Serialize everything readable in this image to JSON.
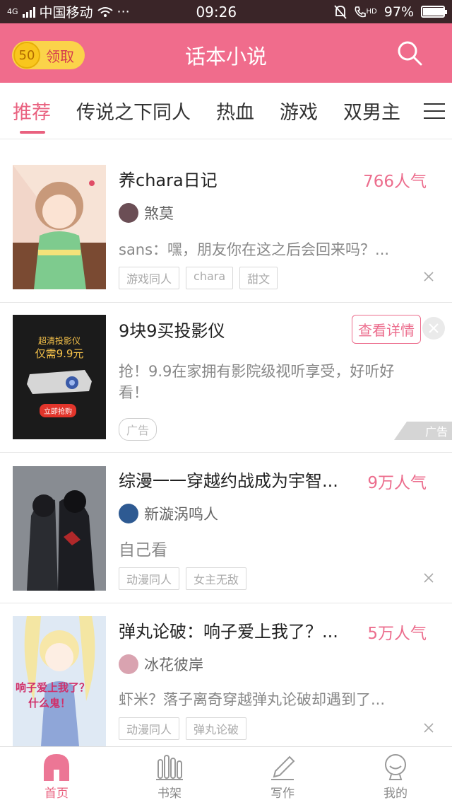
{
  "status_bar": {
    "network": "4G",
    "carrier": "中国移动",
    "dots": "···",
    "time": "09:26",
    "hd": "HD",
    "battery": "97%",
    "battery_level": 0.97
  },
  "app_bar": {
    "coins": "50",
    "claim_label": "领取",
    "title": "话本小说"
  },
  "tabs": [
    {
      "label": "推荐",
      "active": true
    },
    {
      "label": "传说之下同人"
    },
    {
      "label": "热血"
    },
    {
      "label": "游戏"
    },
    {
      "label": "双男主"
    }
  ],
  "feed": [
    {
      "title": "养chara日记",
      "popularity": "766人气",
      "author": "煞莫",
      "desc": "sans：嘿，朋友你在这之后会回来吗？...",
      "tags": [
        "游戏同人",
        "chara",
        "甜文"
      ]
    },
    {
      "ad": true,
      "title": "9块9买投影仪",
      "detail_label": "查看详情",
      "desc_line1": "抢！9.9在家拥有影院级视听享受，好听好",
      "desc_line2": "看！",
      "tag": "广告",
      "corner_label": "广告",
      "cover_title": "超清投影仪",
      "cover_price": "仅需9.9元",
      "cover_button": "立即抢购"
    },
    {
      "title": "综漫一一穿越约战成为宇智...",
      "popularity": "9万人气",
      "author": "新漩涡鸣人",
      "desc": "自己看",
      "tags": [
        "动漫同人",
        "女主无敌"
      ]
    },
    {
      "title": "弹丸论破：响子爱上我了？...",
      "popularity": "5万人气",
      "author": "冰花彼岸",
      "desc": "虾米？落子离奇穿越弹丸论破却遇到了...",
      "tags": [
        "动漫同人",
        "弹丸论破"
      ],
      "cover_text_1": "响子爱上我了？",
      "cover_text_2": "什么鬼！"
    }
  ],
  "bottom_nav": [
    {
      "label": "首页",
      "icon": "home-icon",
      "active": true
    },
    {
      "label": "书架",
      "icon": "bookshelf-icon"
    },
    {
      "label": "写作",
      "icon": "pen-icon"
    },
    {
      "label": "我的",
      "icon": "profile-icon"
    }
  ],
  "colors": {
    "accent": "#f06c8c",
    "status_bar": "#3a2528",
    "coin": "#fbd34a"
  }
}
